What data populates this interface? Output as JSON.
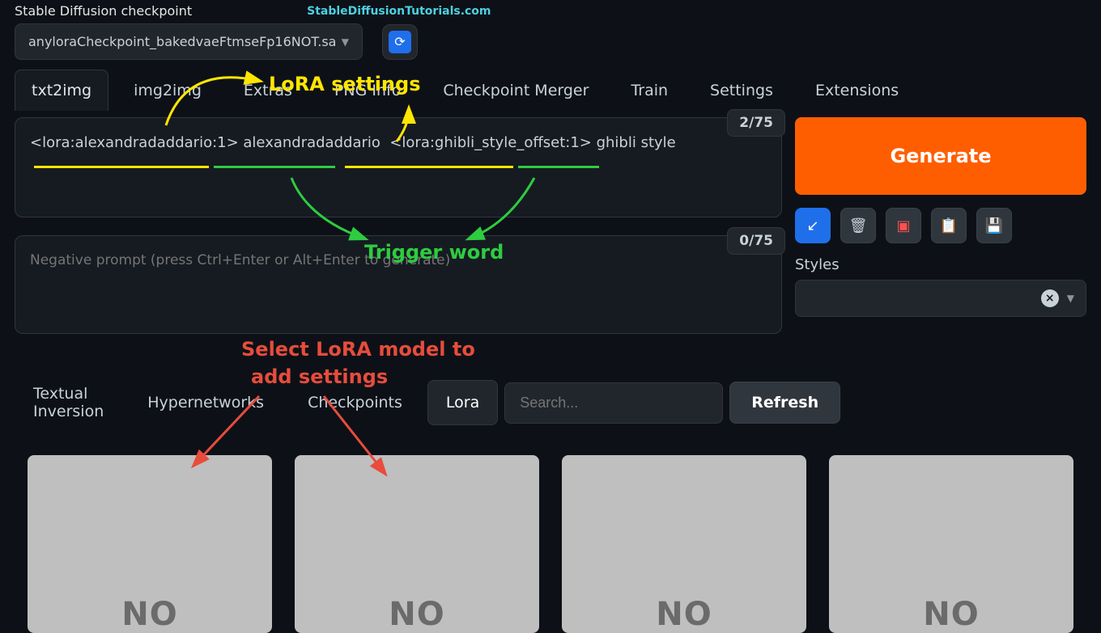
{
  "header": {
    "label": "Stable Diffusion checkpoint",
    "site": "StableDiffusionTutorials.com",
    "checkpoint_value": "anyloraCheckpoint_bakedvaeFtmseFp16NOT.sa"
  },
  "tabs": {
    "items": [
      "txt2img",
      "img2img",
      "Extras",
      "PNG Info",
      "Checkpoint Merger",
      "Train",
      "Settings",
      "Extensions"
    ],
    "active_index": 0
  },
  "prompt": {
    "value": "<lora:alexandradaddario:1> alexandradaddario  <lora:ghibli_style_offset:1> ghibli style",
    "token_count": "2/75"
  },
  "negative": {
    "placeholder": "Negative prompt (press Ctrl+Enter or Alt+Enter to generate)",
    "token_count": "0/75"
  },
  "bottom_tabs": {
    "items": [
      "Textual Inversion",
      "Hypernetworks",
      "Checkpoints",
      "Lora"
    ],
    "active_index": 3,
    "search_placeholder": "Search...",
    "refresh_label": "Refresh"
  },
  "cards": {
    "placeholder_text": "NO"
  },
  "side": {
    "generate_label": "Generate",
    "styles_label": "Styles",
    "icons": {
      "arrow": "↙",
      "trash": "🗑",
      "save": "▣",
      "paste": "📋",
      "disk": "💾"
    }
  },
  "annotations": {
    "lora_settings": "LoRA settings",
    "trigger_word": "Trigger word",
    "select_lora_l1": "Select LoRA model to",
    "select_lora_l2": "add settings"
  }
}
